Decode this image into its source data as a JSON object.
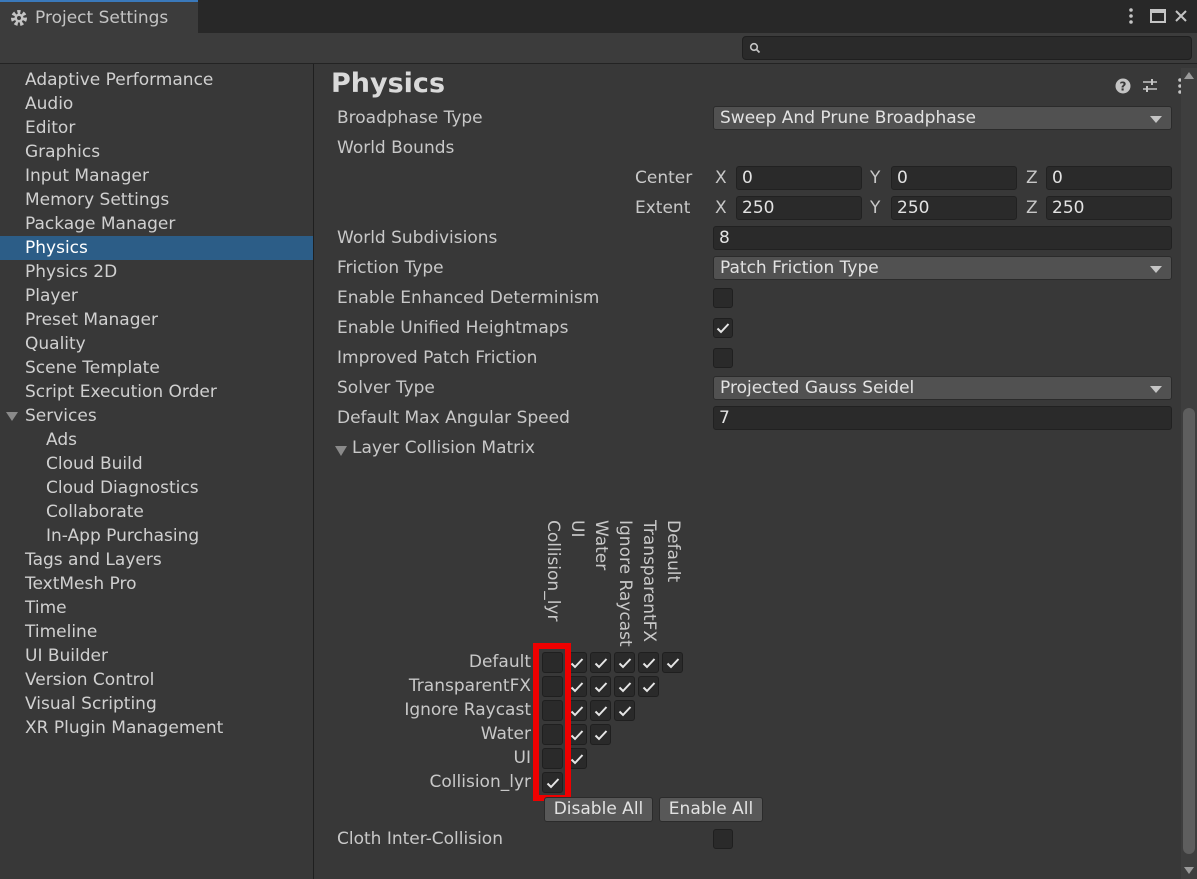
{
  "window": {
    "title": "Project Settings"
  },
  "search": {
    "placeholder": ""
  },
  "sidebar": {
    "items": [
      {
        "label": "Adaptive Performance",
        "level": 0
      },
      {
        "label": "Audio",
        "level": 0
      },
      {
        "label": "Editor",
        "level": 0
      },
      {
        "label": "Graphics",
        "level": 0
      },
      {
        "label": "Input Manager",
        "level": 0
      },
      {
        "label": "Memory Settings",
        "level": 0
      },
      {
        "label": "Package Manager",
        "level": 0
      },
      {
        "label": "Physics",
        "level": 0,
        "active": true
      },
      {
        "label": "Physics 2D",
        "level": 0
      },
      {
        "label": "Player",
        "level": 0
      },
      {
        "label": "Preset Manager",
        "level": 0
      },
      {
        "label": "Quality",
        "level": 0
      },
      {
        "label": "Scene Template",
        "level": 0
      },
      {
        "label": "Script Execution Order",
        "level": 0
      },
      {
        "label": "Services",
        "level": 0,
        "expanded": true
      },
      {
        "label": "Ads",
        "level": 1
      },
      {
        "label": "Cloud Build",
        "level": 1
      },
      {
        "label": "Cloud Diagnostics",
        "level": 1
      },
      {
        "label": "Collaborate",
        "level": 1
      },
      {
        "label": "In-App Purchasing",
        "level": 1
      },
      {
        "label": "Tags and Layers",
        "level": 0
      },
      {
        "label": "TextMesh Pro",
        "level": 0
      },
      {
        "label": "Time",
        "level": 0
      },
      {
        "label": "Timeline",
        "level": 0
      },
      {
        "label": "UI Builder",
        "level": 0
      },
      {
        "label": "Version Control",
        "level": 0
      },
      {
        "label": "Visual Scripting",
        "level": 0
      },
      {
        "label": "XR Plugin Management",
        "level": 0
      }
    ]
  },
  "physics": {
    "title": "Physics",
    "broadphase": {
      "label": "Broadphase Type",
      "value": "Sweep And Prune Broadphase"
    },
    "world_bounds": {
      "label": "World Bounds",
      "center": {
        "label": "Center",
        "x": "0",
        "y": "0",
        "z": "0"
      },
      "extent": {
        "label": "Extent",
        "x": "250",
        "y": "250",
        "z": "250"
      },
      "axis_x": "X",
      "axis_y": "Y",
      "axis_z": "Z"
    },
    "world_subdivisions": {
      "label": "World Subdivisions",
      "value": "8"
    },
    "friction_type": {
      "label": "Friction Type",
      "value": "Patch Friction Type"
    },
    "enhanced_determinism": {
      "label": "Enable Enhanced Determinism",
      "checked": false
    },
    "unified_heightmaps": {
      "label": "Enable Unified Heightmaps",
      "checked": true
    },
    "improved_patch_friction": {
      "label": "Improved Patch Friction",
      "checked": false
    },
    "solver_type": {
      "label": "Solver Type",
      "value": "Projected Gauss Seidel"
    },
    "max_angular_speed": {
      "label": "Default Max Angular Speed",
      "value": "7"
    },
    "layer_matrix": {
      "label": "Layer Collision Matrix",
      "col_labels": [
        "Collision_lyr",
        "UI",
        "Water",
        "Ignore Raycast",
        "TransparentFX",
        "Default"
      ],
      "row_labels": [
        "Default",
        "TransparentFX",
        "Ignore Raycast",
        "Water",
        "UI",
        "Collision_lyr"
      ],
      "rows": [
        [
          false,
          true,
          true,
          true,
          true,
          true
        ],
        [
          false,
          true,
          true,
          true,
          true
        ],
        [
          false,
          true,
          true,
          true
        ],
        [
          false,
          true,
          true
        ],
        [
          false,
          true
        ],
        [
          true
        ]
      ],
      "disable_all": "Disable All",
      "enable_all": "Enable All"
    },
    "cloth_inter_collision": {
      "label": "Cloth Inter-Collision",
      "checked": false
    }
  }
}
